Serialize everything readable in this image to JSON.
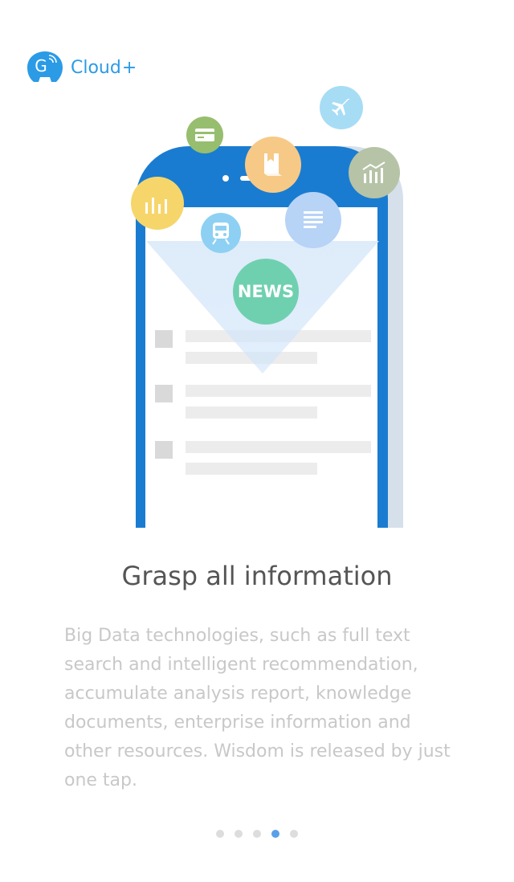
{
  "brand": {
    "name": "Cloud",
    "plus": "+",
    "mark_letter": "G"
  },
  "illustration": {
    "news_label": "NEWS",
    "icons": [
      {
        "name": "bar-chart-icon",
        "color": "#f6d66b"
      },
      {
        "name": "card-icon",
        "color": "#97be6e"
      },
      {
        "name": "book-icon",
        "color": "#f7c987"
      },
      {
        "name": "airplane-icon",
        "color": "#a7dcf5"
      },
      {
        "name": "trend-chart-icon",
        "color": "#b6c3a7"
      },
      {
        "name": "train-icon",
        "color": "#8ed0f3"
      },
      {
        "name": "document-icon",
        "color": "#b7d3f6"
      },
      {
        "name": "news-icon",
        "color": "#6fd0b0"
      }
    ]
  },
  "content": {
    "title": "Grasp all information",
    "description": "Big Data technologies, such as full text search and intelligent recommendation, accumulate analysis report, knowledge documents, enterprise information and other resources. Wisdom is released by just one tap."
  },
  "pager": {
    "total": 5,
    "active_index": 3
  },
  "colors": {
    "brand_blue": "#2b9be6",
    "phone_blue": "#1a7cd0",
    "dot_active": "#5a9fe8",
    "dot_inactive": "#dddddd"
  }
}
